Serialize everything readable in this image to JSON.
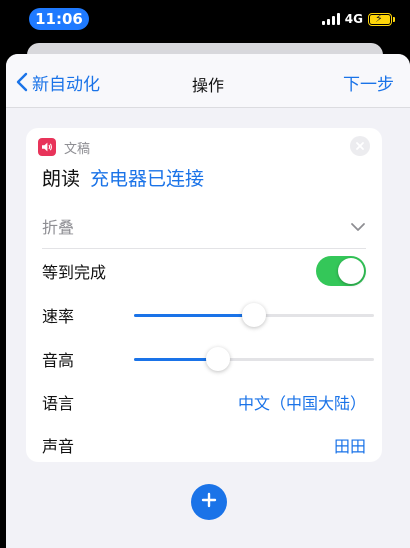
{
  "status_bar": {
    "time": "11:06",
    "network": "4G",
    "battery_charging": true,
    "accent_color": "#1f7aff"
  },
  "navbar": {
    "back_label": "新自动化",
    "title": "操作",
    "next_label": "下一步"
  },
  "action_card": {
    "app_icon": "speaker-icon",
    "app_name": "文稿",
    "verb": "朗读",
    "parameter": "充电器已连接",
    "collapse_label": "折叠",
    "wait_until_finished": {
      "label": "等到完成",
      "enabled": true
    },
    "rate": {
      "label": "速率",
      "value": 0.5
    },
    "pitch": {
      "label": "音高",
      "value": 0.35
    },
    "language": {
      "label": "语言",
      "value": "中文（中国大陆）"
    },
    "voice": {
      "label": "声音",
      "value": "田田"
    }
  },
  "colors": {
    "link": "#1a73e8",
    "toggle_on": "#34c759",
    "app_icon_bg": "#e8345a"
  }
}
